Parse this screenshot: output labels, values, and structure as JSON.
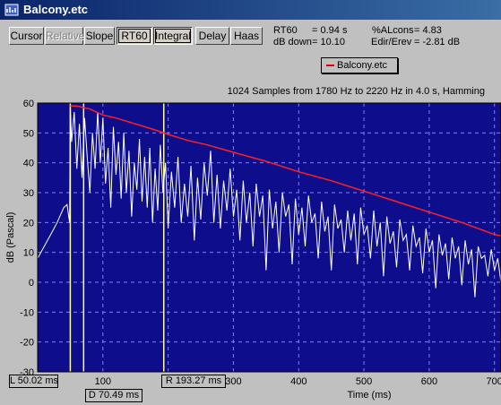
{
  "window": {
    "title": "Balcony.etc"
  },
  "toolbar": {
    "buttons": [
      {
        "label": "Cursor",
        "state": "normal"
      },
      {
        "label": "Relative",
        "state": "disabled"
      },
      {
        "label": "Slope",
        "state": "normal"
      },
      {
        "label": "RT60",
        "state": "pressed"
      },
      {
        "label": "Integral",
        "state": "pressed"
      },
      {
        "label": "Delay",
        "state": "normal"
      },
      {
        "label": "Haas",
        "state": "normal"
      }
    ]
  },
  "readouts": {
    "rt60_label": "RT60",
    "rt60_value": "= 0.94 s",
    "db_down_label": "dB down",
    "db_down_value": "= 10.10",
    "alcons_label": "%ALcons",
    "alcons_value": "= 4.83",
    "edir_label": "Edir/Erev",
    "edir_value": "= -2.81 dB"
  },
  "legend": {
    "label": "Balcony.etc"
  },
  "chart_info": "1024 Samples from 1780 Hz to 2220 Hz in 4.0 s, Hamming",
  "markers": {
    "left": "L 50.02 ms",
    "delay": "D 70.49 ms",
    "right": "R 193.27 ms"
  },
  "colors": {
    "plot_bg": "#0e0e8c",
    "trace": "#ffffff",
    "integral": "#ff2020",
    "markers": "#ffff99",
    "grid": "#8080ff"
  },
  "chart_data": {
    "type": "line",
    "ylabel": "dB (Pascal)",
    "xlabel": "Time (ms)",
    "xlim": [
      0,
      710
    ],
    "ylim": [
      -30,
      60
    ],
    "yticks": [
      60,
      50,
      40,
      30,
      20,
      10,
      0,
      -10,
      -20,
      -30
    ],
    "xticks": [
      100,
      200,
      300,
      400,
      500,
      600,
      700
    ],
    "xtick_labels": [
      "100",
      "2",
      "300",
      "400",
      "500",
      "600",
      "700"
    ],
    "cursor_lines_ms": [
      50.02,
      70.49,
      193.27
    ],
    "series": [
      {
        "role": "etc",
        "x": [
          0,
          10,
          20,
          30,
          40,
          45,
          49,
          50,
          52,
          56,
          60,
          64,
          68,
          72,
          76,
          80,
          84,
          88,
          92,
          96,
          100,
          104,
          108,
          112,
          116,
          120,
          124,
          128,
          132,
          136,
          140,
          144,
          148,
          152,
          156,
          160,
          164,
          168,
          172,
          176,
          180,
          184,
          188,
          192,
          196,
          200,
          205,
          210,
          215,
          220,
          225,
          230,
          235,
          240,
          245,
          250,
          255,
          260,
          265,
          270,
          275,
          280,
          285,
          290,
          295,
          300,
          305,
          310,
          315,
          320,
          325,
          330,
          335,
          340,
          345,
          350,
          355,
          360,
          365,
          370,
          375,
          380,
          385,
          390,
          395,
          400,
          405,
          410,
          415,
          420,
          425,
          430,
          435,
          440,
          445,
          450,
          455,
          460,
          465,
          470,
          475,
          480,
          485,
          490,
          495,
          500,
          505,
          510,
          515,
          520,
          525,
          530,
          535,
          540,
          545,
          550,
          555,
          560,
          565,
          570,
          575,
          580,
          585,
          590,
          595,
          600,
          605,
          610,
          615,
          620,
          625,
          630,
          635,
          640,
          645,
          650,
          655,
          660,
          665,
          670,
          675,
          680,
          685,
          690,
          695,
          700,
          705,
          710
        ],
        "y": [
          8,
          12,
          16,
          20,
          25,
          26,
          20,
          59,
          47,
          57,
          38,
          53,
          35,
          55,
          42,
          30,
          50,
          38,
          57,
          40,
          55,
          33,
          45,
          25,
          52,
          36,
          47,
          28,
          50,
          30,
          44,
          22,
          40,
          31,
          48,
          27,
          42,
          25,
          45,
          20,
          38,
          24,
          46,
          30,
          40,
          18,
          37,
          25,
          42,
          20,
          33,
          22,
          39,
          14,
          35,
          21,
          40,
          29,
          44,
          20,
          36,
          18,
          34,
          24,
          38,
          22,
          31,
          14,
          34,
          20,
          30,
          12,
          33,
          22,
          29,
          4,
          31,
          18,
          27,
          10,
          30,
          22,
          26,
          6,
          28,
          16,
          25,
          12,
          29,
          20,
          23,
          8,
          27,
          17,
          22,
          4,
          26,
          18,
          21,
          10,
          24,
          14,
          23,
          6,
          25,
          16,
          19,
          8,
          24,
          12,
          20,
          2,
          22,
          13,
          17,
          5,
          21,
          14,
          16,
          4,
          19,
          12,
          15,
          3,
          18,
          10,
          14,
          -2,
          16,
          9,
          13,
          1,
          15,
          8,
          12,
          -1,
          14,
          6,
          11,
          -5,
          12,
          8,
          9,
          2,
          11,
          4,
          8,
          0
        ]
      },
      {
        "role": "integral",
        "x": [
          50,
          60,
          80,
          100,
          120,
          150,
          180,
          200,
          230,
          260,
          300,
          350,
          400,
          450,
          500,
          550,
          600,
          650,
          700,
          710
        ],
        "y": [
          59,
          59,
          58,
          56,
          55,
          53,
          51,
          49.5,
          47.5,
          46,
          43.5,
          40.5,
          37,
          34,
          30.5,
          27,
          23.5,
          20,
          16,
          15.5
        ]
      }
    ]
  }
}
